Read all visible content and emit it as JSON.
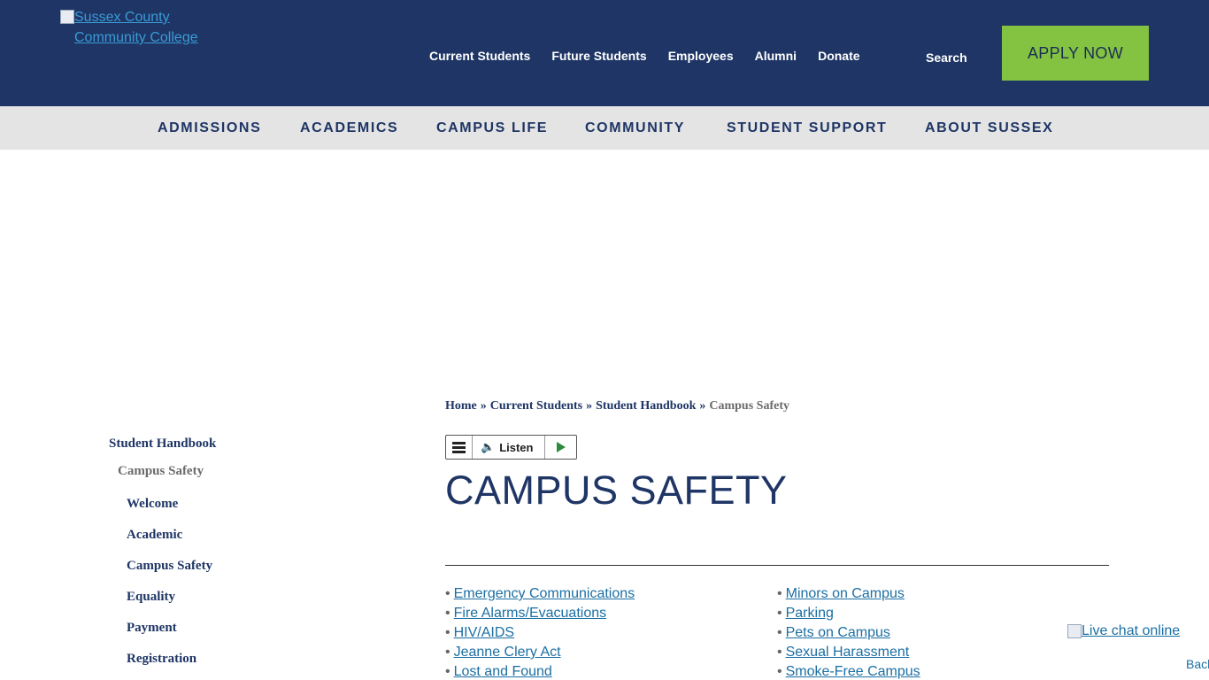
{
  "header": {
    "logo_alt": "Sussex County Community College",
    "utility_nav": [
      "Current Students",
      "Future Students",
      "Employees",
      "Alumni",
      "Donate"
    ],
    "search_label": "Search",
    "apply_label": "APPLY NOW"
  },
  "main_nav": [
    "ADMISSIONS",
    "ACADEMICS",
    "CAMPUS LIFE",
    "COMMUNITY",
    "STUDENT SUPPORT",
    "ABOUT SUSSEX"
  ],
  "breadcrumb": {
    "items": [
      "Home",
      "Current Students",
      "Student Handbook"
    ],
    "separator": "»",
    "current": "Campus Safety"
  },
  "listen_widget": {
    "label": "Listen",
    "speaker_icon": "🔈"
  },
  "page": {
    "title": "CAMPUS SAFETY",
    "bullet": "•",
    "links_left": [
      "Emergency Communications",
      "Fire Alarms/Evacuations",
      "HIV/AIDS",
      "Jeanne Clery Act",
      "Lost and Found"
    ],
    "links_right": [
      "Minors on Campus",
      "Parking",
      "Pets on Campus",
      "Sexual Harassment",
      "Smoke-Free Campus"
    ]
  },
  "sidebar": {
    "parent": "Student Handbook",
    "current": "Campus Safety",
    "items": [
      "Welcome",
      "Academic",
      "Campus Safety",
      "Equality",
      "Payment",
      "Registration"
    ]
  },
  "chat_alt": "Live chat online",
  "corner_alt": "Back",
  "colors": {
    "header_bg": "#1e3565",
    "apply_bg": "#84c341",
    "nav_bg": "#e4e4e4",
    "link": "#1b6fa3"
  }
}
